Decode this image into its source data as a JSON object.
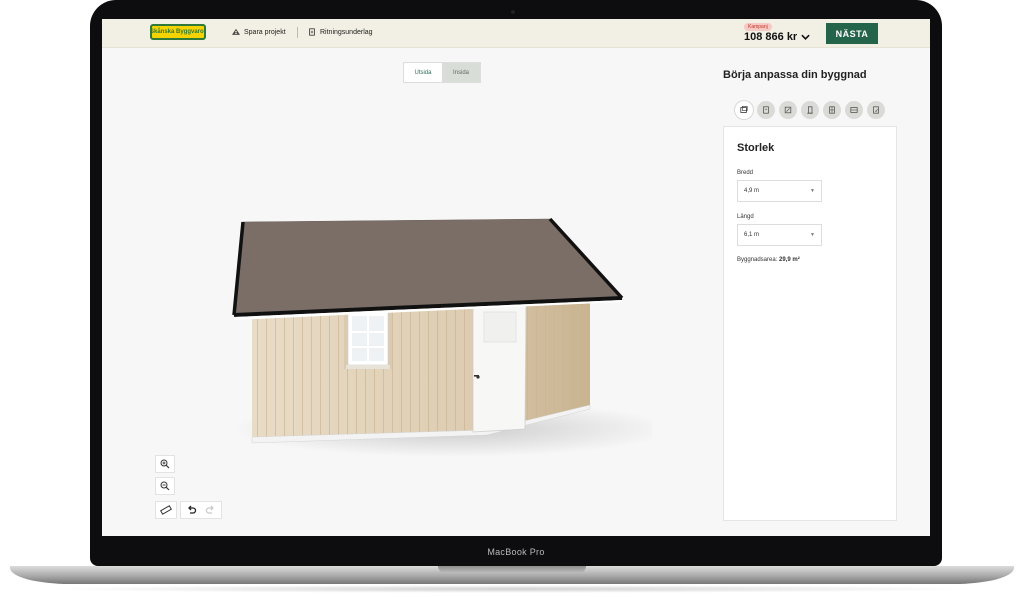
{
  "header": {
    "logo_text": "Skånska Byggvaror",
    "save_project": "Spara projekt",
    "drawing_basis": "Ritningsunderlag",
    "campaign_badge": "Kampanj",
    "price": "108 866 kr",
    "next_button": "NÄSTA"
  },
  "view_toggle": {
    "outside": "Utsida",
    "inside": "Insida"
  },
  "panel": {
    "title": "Börja anpassa din byggnad",
    "section_title": "Storlek",
    "width_label": "Bredd",
    "width_value": "4,9 m",
    "length_label": "Längd",
    "length_value": "6,1 m",
    "area_label": "Byggnadsarea:",
    "area_value": "29,9 m²"
  },
  "tab_icons": [
    "size-icon",
    "walls-icon",
    "facade-icon",
    "door-icon",
    "window-icon",
    "interior-icon",
    "summary-icon"
  ],
  "colors": {
    "brand_green": "#23644a",
    "header_bg": "#f2f0e4",
    "logo_yellow": "#f4d300"
  },
  "device": {
    "label": "MacBook Pro"
  }
}
